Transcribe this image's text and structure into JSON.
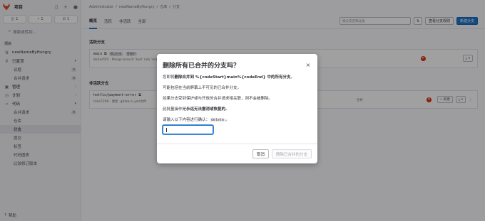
{
  "app": {
    "title": "项目"
  },
  "sidebar": {
    "counters": [
      "1",
      "1",
      "1"
    ],
    "search_label": "搜索或转到...",
    "section_label": "项目",
    "project_name": "newNameByHungry",
    "items": [
      {
        "label": "已置顶",
        "icon": "pin-icon",
        "sub": false,
        "chevron": "▾"
      },
      {
        "label": "议题",
        "badge": "0",
        "sub": true
      },
      {
        "label": "合并请求",
        "badge": "0",
        "sub": true
      },
      {
        "label": "管理",
        "icon": "manage-icon",
        "chevron": "›"
      },
      {
        "label": "计划",
        "icon": "plan-icon",
        "chevron": "›"
      },
      {
        "label": "代码",
        "icon": "code-icon",
        "chevron": "▾"
      },
      {
        "label": "合并请求",
        "badge": "0",
        "sub": true
      },
      {
        "label": "仓库",
        "sub": true
      },
      {
        "label": "分支",
        "sub": true,
        "active": true
      },
      {
        "label": "提交",
        "sub": true
      },
      {
        "label": "标签",
        "sub": true
      },
      {
        "label": "代码图表",
        "sub": true
      },
      {
        "label": "比较修订版本",
        "sub": true
      }
    ],
    "help_label": "帮助"
  },
  "breadcrumb": [
    "Administrator",
    "/",
    "newNameByHungry",
    "/",
    "仓库",
    "/",
    "分支"
  ],
  "tabs": [
    "概览",
    "活跃",
    "非活跃",
    "全部"
  ],
  "toolbar": {
    "filter_placeholder": "按分支名称过滤",
    "sort_icon": "sort-icon",
    "view_rules_label": "查看分支规则",
    "new_branch_label": "新建分支"
  },
  "sections": {
    "active_title": "活跃分支",
    "stale_title": "非活跃分支"
  },
  "branches": [
    {
      "name": "main",
      "tags": [
        "默认分支",
        "受保护"
      ],
      "commit": "8e5ed5f4 · Merge branch 'test' into 'main' ..."
    },
    {
      "name": "hotfix/payment-error",
      "tags": [],
      "commit": "fa0e7290 · 更新 .gitlab-ci.yml文件",
      "status": "合并"
    }
  ],
  "row_actions": {
    "new_label": "新建",
    "download_icon": "download-icon"
  },
  "modal": {
    "title": "删除所有已合并的分支吗？",
    "line1_prefix": "您即将",
    "line1_bold": "删除合并到 %{codeStart}main%{codeEnd} 中的所有分支",
    "line1_suffix": "。",
    "line2": "可能包括在当前屏幕上不可见的已合并分支。",
    "line3": "如果分支受到保护或与开放的合并请求相关联，则不会被删除。",
    "line4_prefix": "此批量操作是",
    "line4_bold": "永远无法撤消或恢复的",
    "line4_suffix": "。",
    "confirm_prefix": "请输入以下内容进行确认：",
    "confirm_code": "delete",
    "confirm_suffix": "。",
    "input_value": "",
    "cancel_label": "取消",
    "delete_label": "删除已合并的分支"
  },
  "colors": {
    "accent": "#1f75cb",
    "danger": "#dd2b0e",
    "logo": "#e24329"
  }
}
